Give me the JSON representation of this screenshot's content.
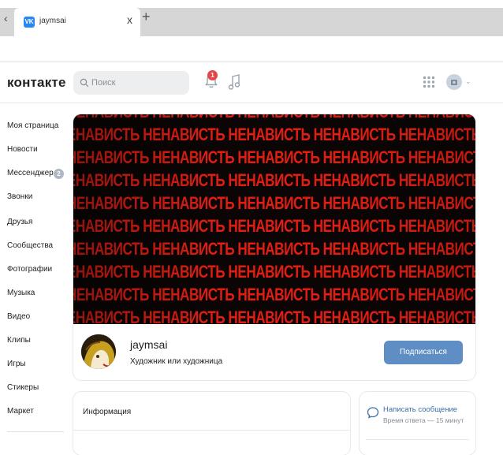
{
  "browser": {
    "tab_title": "jaymsai",
    "tab_close": "x",
    "new_tab": "+",
    "back": "‹",
    "tab_icon_text": "VK"
  },
  "header": {
    "logo_text": "контакте",
    "search_placeholder": "Поиск",
    "notifications_count": "1",
    "icons": [
      "search-icon",
      "bell-icon",
      "music-icon",
      "apps-grid-icon",
      "avatar-icon",
      "chevron-down-icon"
    ]
  },
  "sidebar": {
    "items": [
      {
        "label": "Моя страница"
      },
      {
        "label": "Новости"
      },
      {
        "label": "Мессенджер",
        "badge": "2"
      },
      {
        "label": "Звонки"
      },
      {
        "label": "Друзья"
      },
      {
        "label": "Сообщества"
      },
      {
        "label": "Фотографии"
      },
      {
        "label": "Музыка"
      },
      {
        "label": "Видео"
      },
      {
        "label": "Клипы"
      },
      {
        "label": "Игры"
      },
      {
        "label": "Стикеры"
      },
      {
        "label": "Маркет"
      }
    ]
  },
  "profile": {
    "cover_word": "НЕНАВИСТЬ",
    "name": "jaymsai",
    "description": "Художник или художница",
    "subscribe_label": "Подписаться"
  },
  "info": {
    "title": "Информация"
  },
  "message": {
    "title": "Написать сообщение",
    "response_time": "Время ответа — 15 минут"
  },
  "colors": {
    "accent": "#5f8ec4",
    "cover_text": "#e21d12",
    "cover_bg": "#0b0505",
    "badge": "#e64646"
  }
}
